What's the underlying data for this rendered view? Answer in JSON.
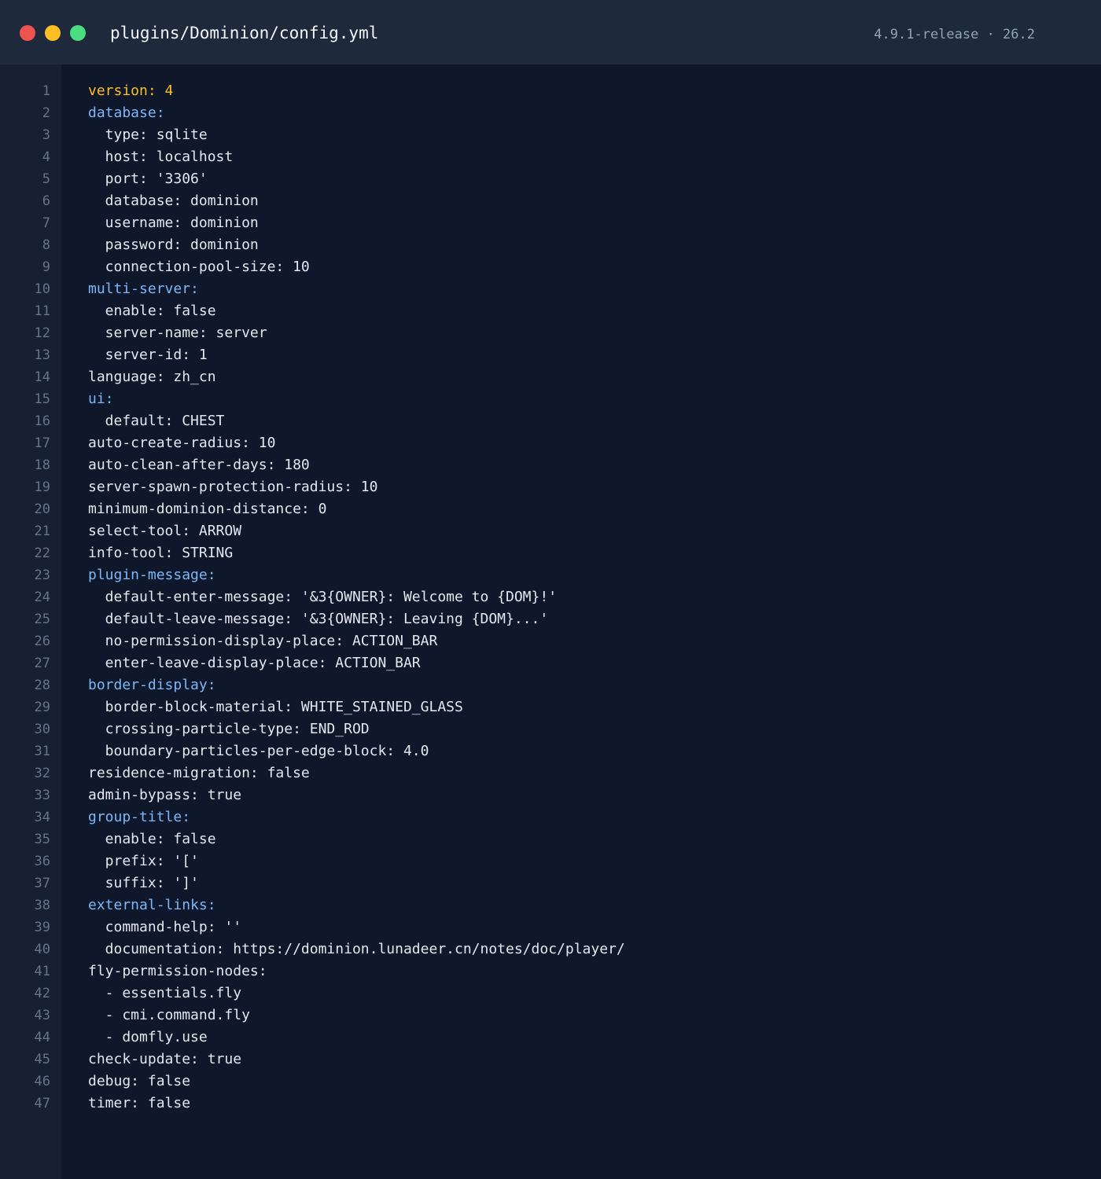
{
  "window": {
    "title": "plugins/Dominion/config.yml",
    "meta": "4.9.1-release · 26.2",
    "colors": {
      "close": "#ef5350",
      "minimize": "#fbbf24",
      "maximize": "#4ade80",
      "section_key": "#7cb8f8",
      "version_key": "#fbbf24",
      "text": "#e2e8f0",
      "line_number": "#64748b"
    }
  },
  "lines": [
    {
      "n": "1",
      "text": "version: 4",
      "kind": "version"
    },
    {
      "n": "2",
      "text": "database:",
      "kind": "section"
    },
    {
      "n": "3",
      "text": "  type: sqlite",
      "kind": "plain"
    },
    {
      "n": "4",
      "text": "  host: localhost",
      "kind": "plain"
    },
    {
      "n": "5",
      "text": "  port: '3306'",
      "kind": "plain"
    },
    {
      "n": "6",
      "text": "  database: dominion",
      "kind": "plain"
    },
    {
      "n": "7",
      "text": "  username: dominion",
      "kind": "plain"
    },
    {
      "n": "8",
      "text": "  password: dominion",
      "kind": "plain"
    },
    {
      "n": "9",
      "text": "  connection-pool-size: 10",
      "kind": "plain"
    },
    {
      "n": "10",
      "text": "multi-server:",
      "kind": "section"
    },
    {
      "n": "11",
      "text": "  enable: false",
      "kind": "plain"
    },
    {
      "n": "12",
      "text": "  server-name: server",
      "kind": "plain"
    },
    {
      "n": "13",
      "text": "  server-id: 1",
      "kind": "plain"
    },
    {
      "n": "14",
      "text": "language: zh_cn",
      "kind": "plain"
    },
    {
      "n": "15",
      "text": "ui:",
      "kind": "section"
    },
    {
      "n": "16",
      "text": "  default: CHEST",
      "kind": "plain"
    },
    {
      "n": "17",
      "text": "auto-create-radius: 10",
      "kind": "plain"
    },
    {
      "n": "18",
      "text": "auto-clean-after-days: 180",
      "kind": "plain"
    },
    {
      "n": "19",
      "text": "server-spawn-protection-radius: 10",
      "kind": "plain"
    },
    {
      "n": "20",
      "text": "minimum-dominion-distance: 0",
      "kind": "plain"
    },
    {
      "n": "21",
      "text": "select-tool: ARROW",
      "kind": "plain"
    },
    {
      "n": "22",
      "text": "info-tool: STRING",
      "kind": "plain"
    },
    {
      "n": "23",
      "text": "plugin-message:",
      "kind": "section"
    },
    {
      "n": "24",
      "text": "  default-enter-message: '&3{OWNER}: Welcome to {DOM}!'",
      "kind": "plain"
    },
    {
      "n": "25",
      "text": "  default-leave-message: '&3{OWNER}: Leaving {DOM}...'",
      "kind": "plain"
    },
    {
      "n": "26",
      "text": "  no-permission-display-place: ACTION_BAR",
      "kind": "plain"
    },
    {
      "n": "27",
      "text": "  enter-leave-display-place: ACTION_BAR",
      "kind": "plain"
    },
    {
      "n": "28",
      "text": "border-display:",
      "kind": "section"
    },
    {
      "n": "29",
      "text": "  border-block-material: WHITE_STAINED_GLASS",
      "kind": "plain"
    },
    {
      "n": "30",
      "text": "  crossing-particle-type: END_ROD",
      "kind": "plain"
    },
    {
      "n": "31",
      "text": "  boundary-particles-per-edge-block: 4.0",
      "kind": "plain"
    },
    {
      "n": "32",
      "text": "residence-migration: false",
      "kind": "plain"
    },
    {
      "n": "33",
      "text": "admin-bypass: true",
      "kind": "plain"
    },
    {
      "n": "34",
      "text": "group-title:",
      "kind": "section"
    },
    {
      "n": "35",
      "text": "  enable: false",
      "kind": "plain"
    },
    {
      "n": "36",
      "text": "  prefix: '['",
      "kind": "plain"
    },
    {
      "n": "37",
      "text": "  suffix: ']'",
      "kind": "plain"
    },
    {
      "n": "38",
      "text": "external-links:",
      "kind": "section"
    },
    {
      "n": "39",
      "text": "  command-help: ''",
      "kind": "plain"
    },
    {
      "n": "40",
      "text": "  documentation: https://dominion.lunadeer.cn/notes/doc/player/",
      "kind": "plain"
    },
    {
      "n": "41",
      "text": "fly-permission-nodes:",
      "kind": "plain"
    },
    {
      "n": "42",
      "text": "  - essentials.fly",
      "kind": "plain"
    },
    {
      "n": "43",
      "text": "  - cmi.command.fly",
      "kind": "plain"
    },
    {
      "n": "44",
      "text": "  - domfly.use",
      "kind": "plain"
    },
    {
      "n": "45",
      "text": "check-update: true",
      "kind": "plain"
    },
    {
      "n": "46",
      "text": "debug: false",
      "kind": "plain"
    },
    {
      "n": "47",
      "text": "timer: false",
      "kind": "plain"
    }
  ]
}
